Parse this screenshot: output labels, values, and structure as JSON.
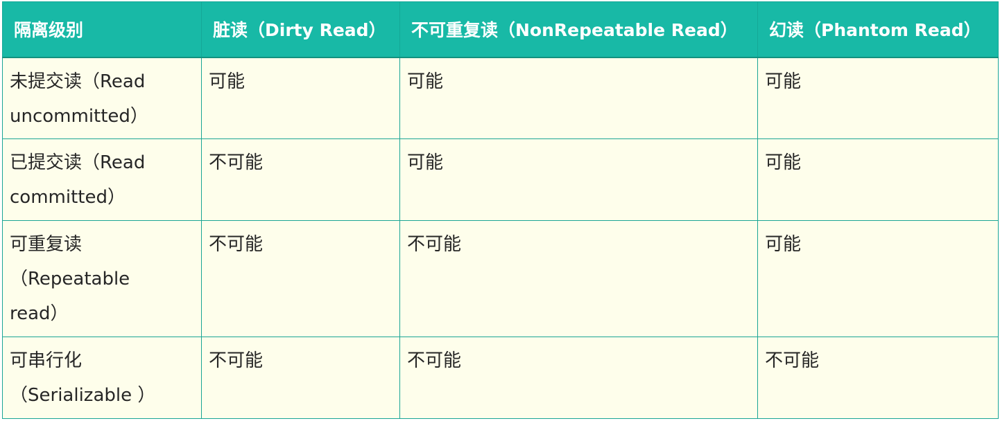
{
  "table": {
    "headers": [
      "隔离级别",
      "脏读（Dirty Read）",
      "不可重复读（NonRepeatable Read）",
      "幻读（Phantom Read）"
    ],
    "rows": [
      {
        "level_lines": [
          "未提交读（Read",
          "uncommitted）"
        ],
        "dirty_read": "可能",
        "nonrepeatable_read": "可能",
        "phantom_read": "可能"
      },
      {
        "level_lines": [
          "已提交读（Read",
          "committed）"
        ],
        "dirty_read": "不可能",
        "nonrepeatable_read": "可能",
        "phantom_read": "可能"
      },
      {
        "level_lines": [
          "可重复读",
          "（Repeatable",
          "read）"
        ],
        "dirty_read": "不可能",
        "nonrepeatable_read": "不可能",
        "phantom_read": "可能"
      },
      {
        "level_lines": [
          "可串行化",
          "（Serializable ）"
        ],
        "dirty_read": "不可能",
        "nonrepeatable_read": "不可能",
        "phantom_read": "不可能"
      }
    ]
  },
  "colors": {
    "header_bg": "#18b9a6",
    "header_text": "#ffffff",
    "cell_bg": "#fefeeb",
    "border": "#1aa595"
  }
}
